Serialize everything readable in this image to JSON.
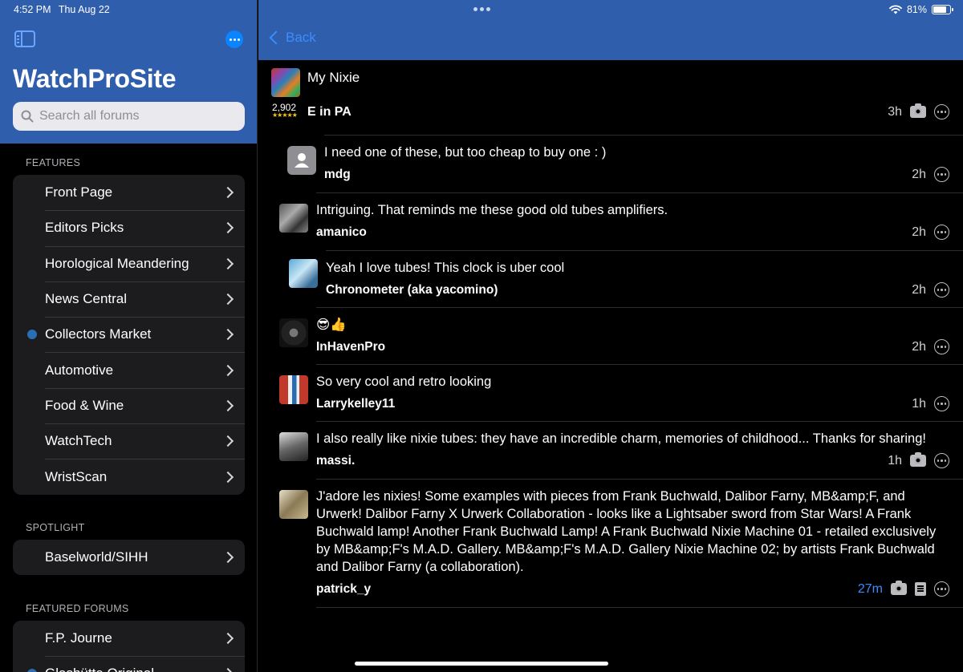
{
  "status": {
    "time": "4:52 PM",
    "date": "Thu Aug 22",
    "battery": "81%",
    "battery_fraction": 0.81
  },
  "sidebar": {
    "app_title": "WatchProSite",
    "search_placeholder": "Search all forums",
    "sections": {
      "features": {
        "label": "FEATURES",
        "items": [
          {
            "label": "Front Page",
            "dot": false
          },
          {
            "label": "Editors Picks",
            "dot": false
          },
          {
            "label": "Horological Meandering",
            "dot": false
          },
          {
            "label": "News Central",
            "dot": false
          },
          {
            "label": "Collectors Market",
            "dot": true
          },
          {
            "label": "Automotive",
            "dot": false
          },
          {
            "label": "Food & Wine",
            "dot": false
          },
          {
            "label": "WatchTech",
            "dot": false
          },
          {
            "label": "WristScan",
            "dot": false
          }
        ]
      },
      "spotlight": {
        "label": "SPOTLIGHT",
        "items": [
          {
            "label": "Baselworld/SIHH",
            "dot": false
          }
        ]
      },
      "featured_forums": {
        "label": "FEATURED FORUMS",
        "items": [
          {
            "label": "F.P. Journe",
            "dot": false
          },
          {
            "label": "Glashütte Original",
            "dot": true
          }
        ]
      }
    }
  },
  "nav": {
    "back_label": "Back"
  },
  "post": {
    "title": "My Nixie",
    "author": "E in PA",
    "post_count": "2,902",
    "stars": "★★★★★",
    "time": "3h"
  },
  "replies": [
    {
      "text": "I need one of these, but too cheap to buy one : )",
      "author": "mdg",
      "time": "2h",
      "camera": false,
      "doc": false
    },
    {
      "text": "Intriguing. That reminds me these good old tubes amplifiers.",
      "author": "amanico",
      "time": "2h",
      "camera": false,
      "doc": false
    },
    {
      "text": "Yeah I love tubes!  This clock is uber cool",
      "author": "Chronometer (aka yacomino)",
      "time": "2h",
      "camera": false,
      "doc": false
    },
    {
      "text": "😎👍",
      "author": "InHavenPro",
      "time": "2h",
      "camera": false,
      "doc": false
    },
    {
      "text": "So very cool and retro looking",
      "author": "Larrykelley11",
      "time": "1h",
      "camera": false,
      "doc": false
    },
    {
      "text": "I also really like nixie tubes: they have an incredible charm, memories of childhood... Thanks for sharing!",
      "author": "massi.",
      "time": "1h",
      "camera": true,
      "doc": false
    },
    {
      "text": "J'adore les nixies! Some examples with pieces from Frank Buchwald, Dalibor Farny, MB&amp;F, and Urwerk! Dalibor Farny X Urwerk Collaboration - looks like a Lightsaber sword from Star Wars! A Frank Buchwald lamp! Another Frank Buchwald Lamp! A Frank Buchwald Nixie Machine 01 - retailed exclusively by MB&amp;F's M.A.D. Gallery. MB&amp;F's M.A.D. Gallery Nixie Machine 02; by artists Frank Buchwald and Dalibor Farny (a collaboration).",
      "author": "patrick_y",
      "time": "27m",
      "camera": true,
      "doc": true,
      "time_highlight": true
    }
  ],
  "colors": {
    "bar_blue": "#2f5ead",
    "link_blue": "#3b8cff",
    "unread_dot": "#2a6fb6"
  }
}
